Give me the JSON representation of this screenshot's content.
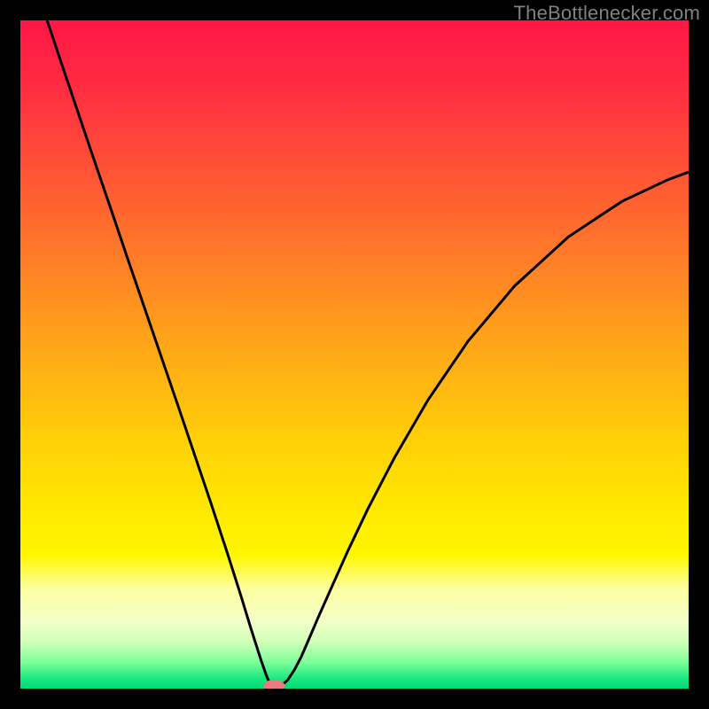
{
  "watermark": "TheBottlenecker.com",
  "chart_data": {
    "type": "line",
    "title": "",
    "xlabel": "",
    "ylabel": "",
    "xlim": [
      0,
      1
    ],
    "ylim": [
      0,
      1
    ],
    "gradient_stops": [
      {
        "offset": 0.0,
        "color": "#ff1747"
      },
      {
        "offset": 0.09,
        "color": "#ff2a42"
      },
      {
        "offset": 0.22,
        "color": "#ff5136"
      },
      {
        "offset": 0.37,
        "color": "#ff8126"
      },
      {
        "offset": 0.5,
        "color": "#ffaa17"
      },
      {
        "offset": 0.63,
        "color": "#ffd008"
      },
      {
        "offset": 0.73,
        "color": "#ffe800"
      },
      {
        "offset": 0.8,
        "color": "#fff700"
      },
      {
        "offset": 0.85,
        "color": "#fdffa0"
      },
      {
        "offset": 0.9,
        "color": "#f2ffc8"
      },
      {
        "offset": 0.93,
        "color": "#d0ffb8"
      },
      {
        "offset": 0.96,
        "color": "#80ff9a"
      },
      {
        "offset": 0.985,
        "color": "#1ae87f"
      },
      {
        "offset": 1.0,
        "color": "#00d879"
      }
    ],
    "series": [
      {
        "name": "curve",
        "x": [
          0.04,
          0.06,
          0.085,
          0.11,
          0.135,
          0.16,
          0.185,
          0.21,
          0.235,
          0.26,
          0.285,
          0.31,
          0.33,
          0.345,
          0.36,
          0.368,
          0.374,
          0.378,
          0.38,
          0.385,
          0.39,
          0.4,
          0.41,
          0.42,
          0.43,
          0.445,
          0.465,
          0.49,
          0.52,
          0.56,
          0.61,
          0.67,
          0.74,
          0.82,
          0.9,
          0.97,
          1.0
        ],
        "y": [
          1.0,
          0.94,
          0.866,
          0.792,
          0.719,
          0.645,
          0.572,
          0.499,
          0.426,
          0.352,
          0.278,
          0.202,
          0.139,
          0.09,
          0.043,
          0.02,
          0.006,
          0.001,
          0.0,
          0.001,
          0.004,
          0.013,
          0.028,
          0.047,
          0.07,
          0.105,
          0.15,
          0.206,
          0.269,
          0.346,
          0.432,
          0.52,
          0.603,
          0.676,
          0.729,
          0.762,
          0.773
        ]
      }
    ],
    "marker": {
      "x": 0.38,
      "y": 0.0,
      "rx": 12,
      "ry": 7,
      "color": "#e77b7f"
    }
  }
}
